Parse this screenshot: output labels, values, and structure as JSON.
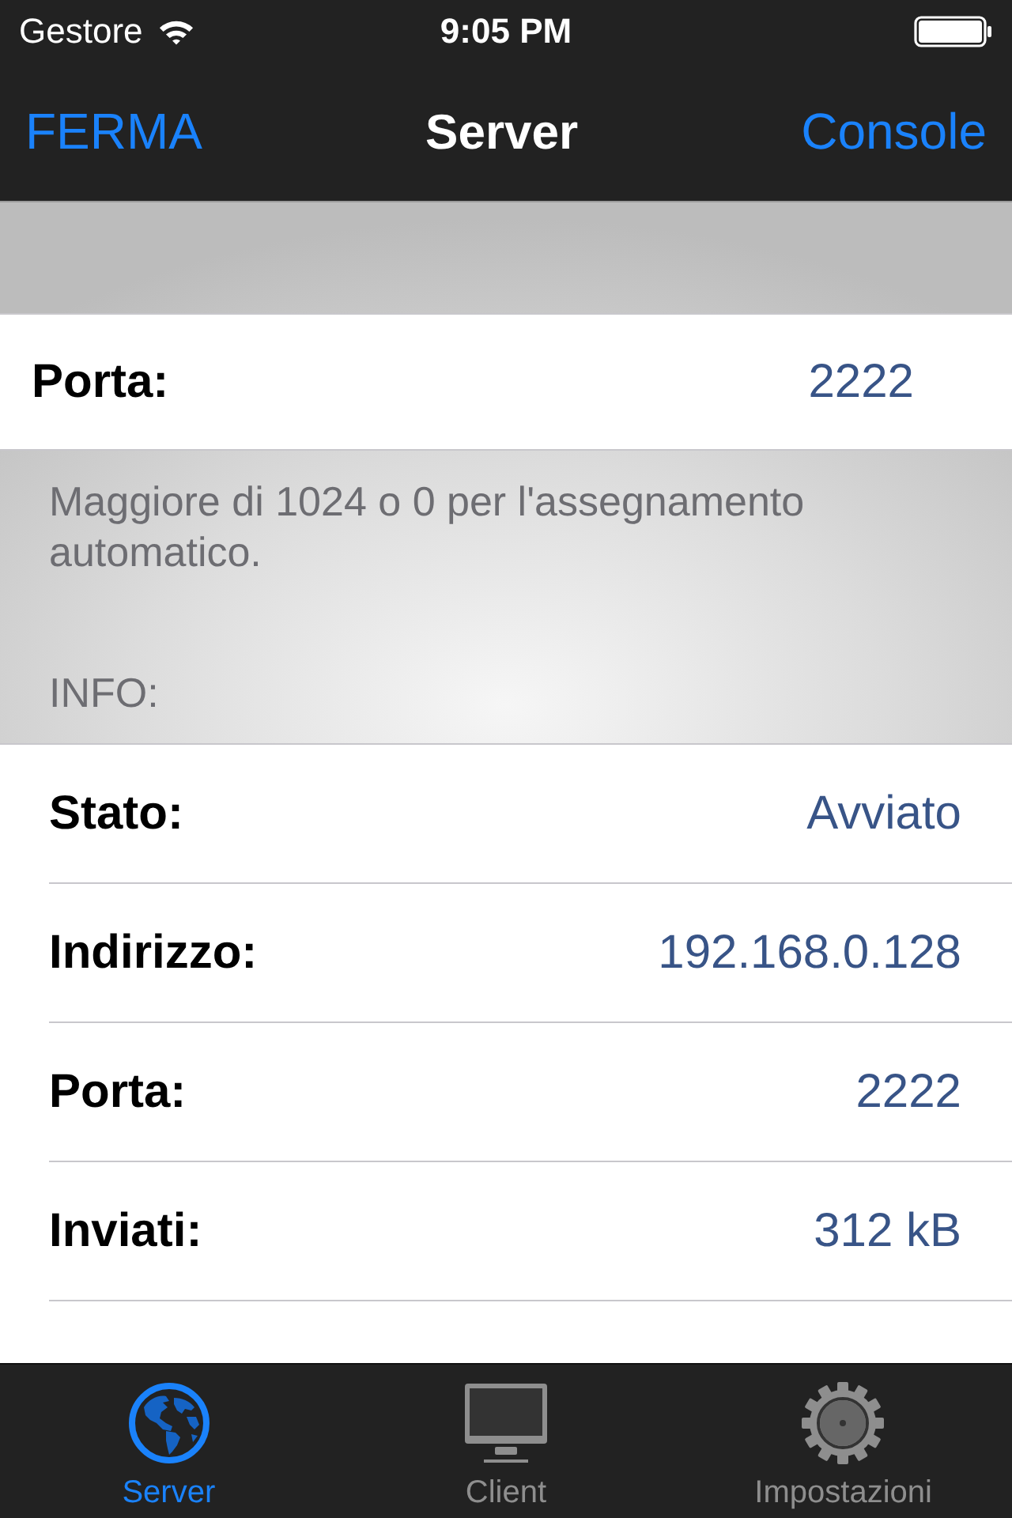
{
  "status_bar": {
    "carrier": "Gestore",
    "time": "9:05 PM"
  },
  "nav_bar": {
    "left_button": "FERMA",
    "title": "Server",
    "right_button": "Console"
  },
  "port_section": {
    "label": "Porta:",
    "value": "2222",
    "footer": "Maggiore di 1024 o 0 per l'assegnamento automatico."
  },
  "info_section": {
    "header": "INFO:",
    "rows": [
      {
        "label": "Stato:",
        "value": "Avviato"
      },
      {
        "label": "Indirizzo:",
        "value": "192.168.0.128"
      },
      {
        "label": "Porta:",
        "value": "2222"
      },
      {
        "label": "Inviati:",
        "value": "312 kB"
      }
    ]
  },
  "tab_bar": {
    "tabs": [
      {
        "label": "Server",
        "selected": true
      },
      {
        "label": "Client",
        "selected": false
      },
      {
        "label": "Impostazioni",
        "selected": false
      }
    ]
  }
}
